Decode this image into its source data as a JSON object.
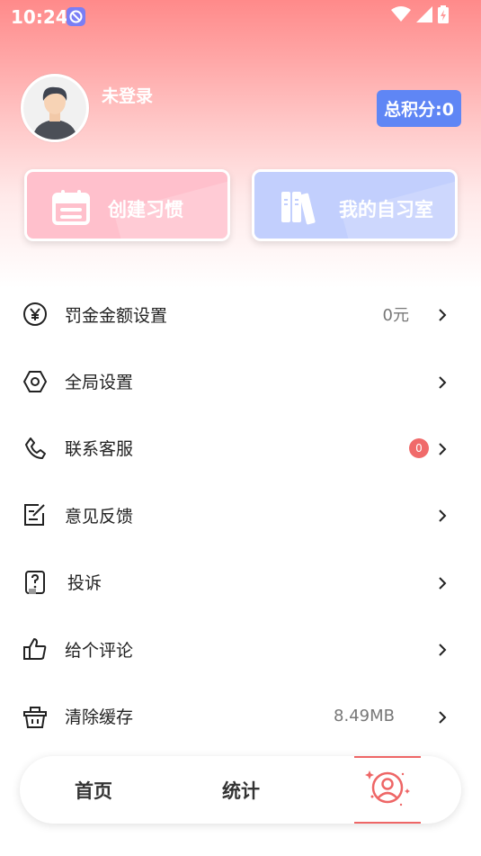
{
  "status_bar": {
    "time": "10:24",
    "icons": [
      "wifi-icon",
      "signal-icon",
      "battery-icon"
    ]
  },
  "profile": {
    "name": "未登录",
    "points_label": "总积分:0",
    "avatar_icon": "user-avatar"
  },
  "quick_cards": {
    "create_habit": {
      "label": "创建习惯",
      "icon": "calendar-icon",
      "color": "#ffc0cc"
    },
    "study_room": {
      "label": "我的自习室",
      "icon": "books-icon",
      "color": "#c2cffd"
    }
  },
  "menu": {
    "items": [
      {
        "label": "罚金金额设置",
        "value": "0元",
        "icon": "yen-icon"
      },
      {
        "label": "全局设置",
        "icon": "settings-hex-icon"
      },
      {
        "label": "联系客服",
        "badge": "0",
        "icon": "phone-icon"
      },
      {
        "label": "意见反馈",
        "icon": "feedback-edit-icon"
      },
      {
        "label": "投诉",
        "icon": "complaint-icon"
      },
      {
        "label": "给个评论",
        "icon": "thumbs-up-icon"
      },
      {
        "label": "清除缓存",
        "value": "8.49MB",
        "icon": "basket-icon"
      }
    ]
  },
  "bottom_nav": {
    "home": "首页",
    "stats": "统计",
    "profile_icon": "profile-icon"
  },
  "colors": {
    "accent": "#5f86f5",
    "header_red": "#ff8a8a",
    "badge_red": "#f06a6a"
  }
}
